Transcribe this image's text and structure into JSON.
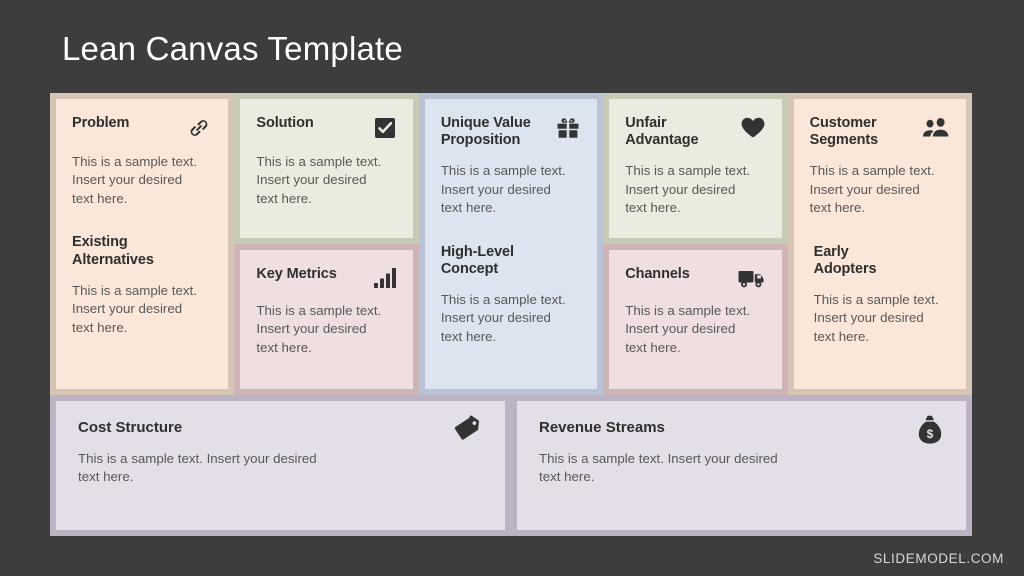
{
  "slide": {
    "title": "Lean Canvas Template",
    "background_color": "#3d3d3d",
    "panel_color": "#f2f2f2",
    "watermark": "SLIDEMODEL.COM"
  },
  "sample_text": "This is a sample text.\nInsert your desired\ntext here.",
  "sample_text_wide": "This is a sample text. Insert your desired\ntext here.",
  "columns": [
    {
      "frame_color": "#d6c4b4",
      "fill_color": "#fbe7da",
      "blocks": [
        {
          "title": "Problem",
          "icon": "link-icon",
          "body": "This is a sample text.\nInsert your desired\ntext here."
        },
        {
          "title": "Existing\nAlternatives",
          "icon": "none",
          "body": "This is a sample text.\nInsert your desired\ntext here."
        }
      ]
    },
    {
      "top": {
        "frame_color": "#c6cbb6",
        "fill_color": "#e9eddf",
        "title": "Solution",
        "icon": "checkmark-icon",
        "body": "This is a sample text.\nInsert your desired\ntext here."
      },
      "bottom": {
        "frame_color": "#cfb3b7",
        "fill_color": "#f0dfe0",
        "title": "Key Metrics",
        "icon": "bar-chart-icon",
        "body": "This is a sample text.\nInsert your desired\ntext here."
      }
    },
    {
      "frame_color": "#b9c3d4",
      "fill_color": "#dce4f0",
      "blocks": [
        {
          "title": "Unique Value\nProposition",
          "icon": "gift-icon",
          "body": "This is a sample text.\nInsert your desired\ntext here."
        },
        {
          "title": "High-Level\nConcept",
          "icon": "none",
          "body": "This is a sample text.\nInsert your desired\ntext here."
        }
      ]
    },
    {
      "top": {
        "frame_color": "#c6cbb6",
        "fill_color": "#e9eddf",
        "title": "Unfair\nAdvantage",
        "icon": "heart-icon",
        "body": "This is a sample text.\nInsert your desired\ntext here."
      },
      "bottom": {
        "frame_color": "#cfb3b7",
        "fill_color": "#f0dfe0",
        "title": "Channels",
        "icon": "truck-icon",
        "body": "This is a sample text.\nInsert your desired\ntext here."
      }
    },
    {
      "frame_color": "#d6c4b4",
      "fill_color": "#fbe7da",
      "blocks": [
        {
          "title": "Customer\nSegments",
          "icon": "people-icon",
          "body": "This is a sample text.\nInsert your desired\ntext here."
        },
        {
          "title": "Early\nAdopters",
          "icon": "none",
          "body": "This is a sample text.\nInsert your desired\ntext here."
        }
      ]
    }
  ],
  "bottom_row": [
    {
      "frame_color": "#bcb3c4",
      "fill_color": "#e4dee8",
      "title": "Cost Structure",
      "icon": "price-tag-icon",
      "body": "This is a sample text. Insert your desired\ntext here."
    },
    {
      "frame_color": "#bcb3c4",
      "fill_color": "#e4dee8",
      "title": "Revenue Streams",
      "icon": "money-bag-icon",
      "body": "This is a sample text. Insert your desired\ntext here."
    }
  ]
}
